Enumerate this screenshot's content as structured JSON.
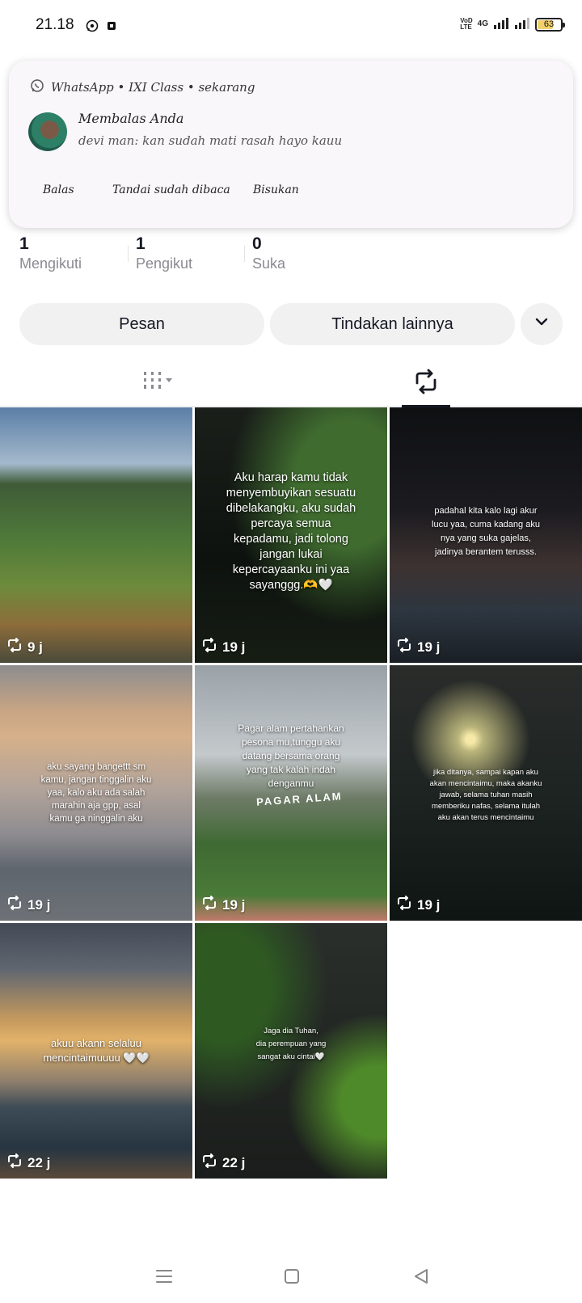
{
  "status_bar": {
    "time": "21.18",
    "network_label_top": "VoD",
    "network_label_bottom": "LTE",
    "network_type": "4G",
    "battery": "63",
    "battery_level": 0.63
  },
  "notification": {
    "header": "WhatsApp • IXI Class • sekarang",
    "title": "Membalas Anda",
    "message": "devi man: kan sudah mati rasah hayo kauu",
    "actions": [
      "Balas",
      "Tandai sudah dibaca",
      "Bisukan"
    ]
  },
  "stats": [
    {
      "value": "1",
      "label": "Mengikuti"
    },
    {
      "value": "1",
      "label": "Pengikut"
    },
    {
      "value": "0",
      "label": "Suka"
    }
  ],
  "buttons": {
    "message": "Pesan",
    "more_actions": "Tindakan lainnya",
    "dropdown_icon": "chevron-down-icon"
  },
  "tabs": {
    "videos_icon": "grid-icon",
    "repost_icon": "repost-icon",
    "active": "repost"
  },
  "videos": [
    {
      "caption": "",
      "time": "9 j"
    },
    {
      "caption": "Aku harap kamu tidak\nmenyembuyikan sesuatu\ndibelakangku, aku sudah\npercaya semua\nkepadamu, jadi tolong\njangan lukai\nkepercayaanku ini yaa\nsayanggg.🫶🤍",
      "time": "19 j"
    },
    {
      "caption": "padahal kita kalo lagi akur\nlucu yaa, cuma kadang aku\nnya yang suka gajelas,\njadinya berantem terusss.",
      "time": "19 j"
    },
    {
      "caption": "aku sayang bangettt sm\nkamu, jangan tinggalin aku\nyaa, kalo aku ada salah\nmarahin aja gpp, asal\nkamu ga ninggalin aku",
      "time": "19 j"
    },
    {
      "caption": "Pagar alam pertahankan\npesona mu,tunggu aku\ndatang  bersama orang\nyang tak kalah indah\ndenganmu",
      "time": "19 j"
    },
    {
      "caption": "jika ditanya, sampai kapan aku\nakan mencintaimu, maka akanku\njawab, selama tuhan masih\nmemberiku nafas, selama itulah\naku akan terus mencintaimu",
      "time": "19 j"
    },
    {
      "caption": "akuu akann selaluu\nmencintaimuuuu 🤍🤍",
      "time": "22 j"
    },
    {
      "caption": "Jaga dia Tuhan,\ndia perempuan yang\nsangat aku cintai🤍",
      "time": "22 j"
    }
  ],
  "navbar": {
    "icons": [
      "menu-icon",
      "home-square-icon",
      "back-triangle-icon"
    ]
  }
}
